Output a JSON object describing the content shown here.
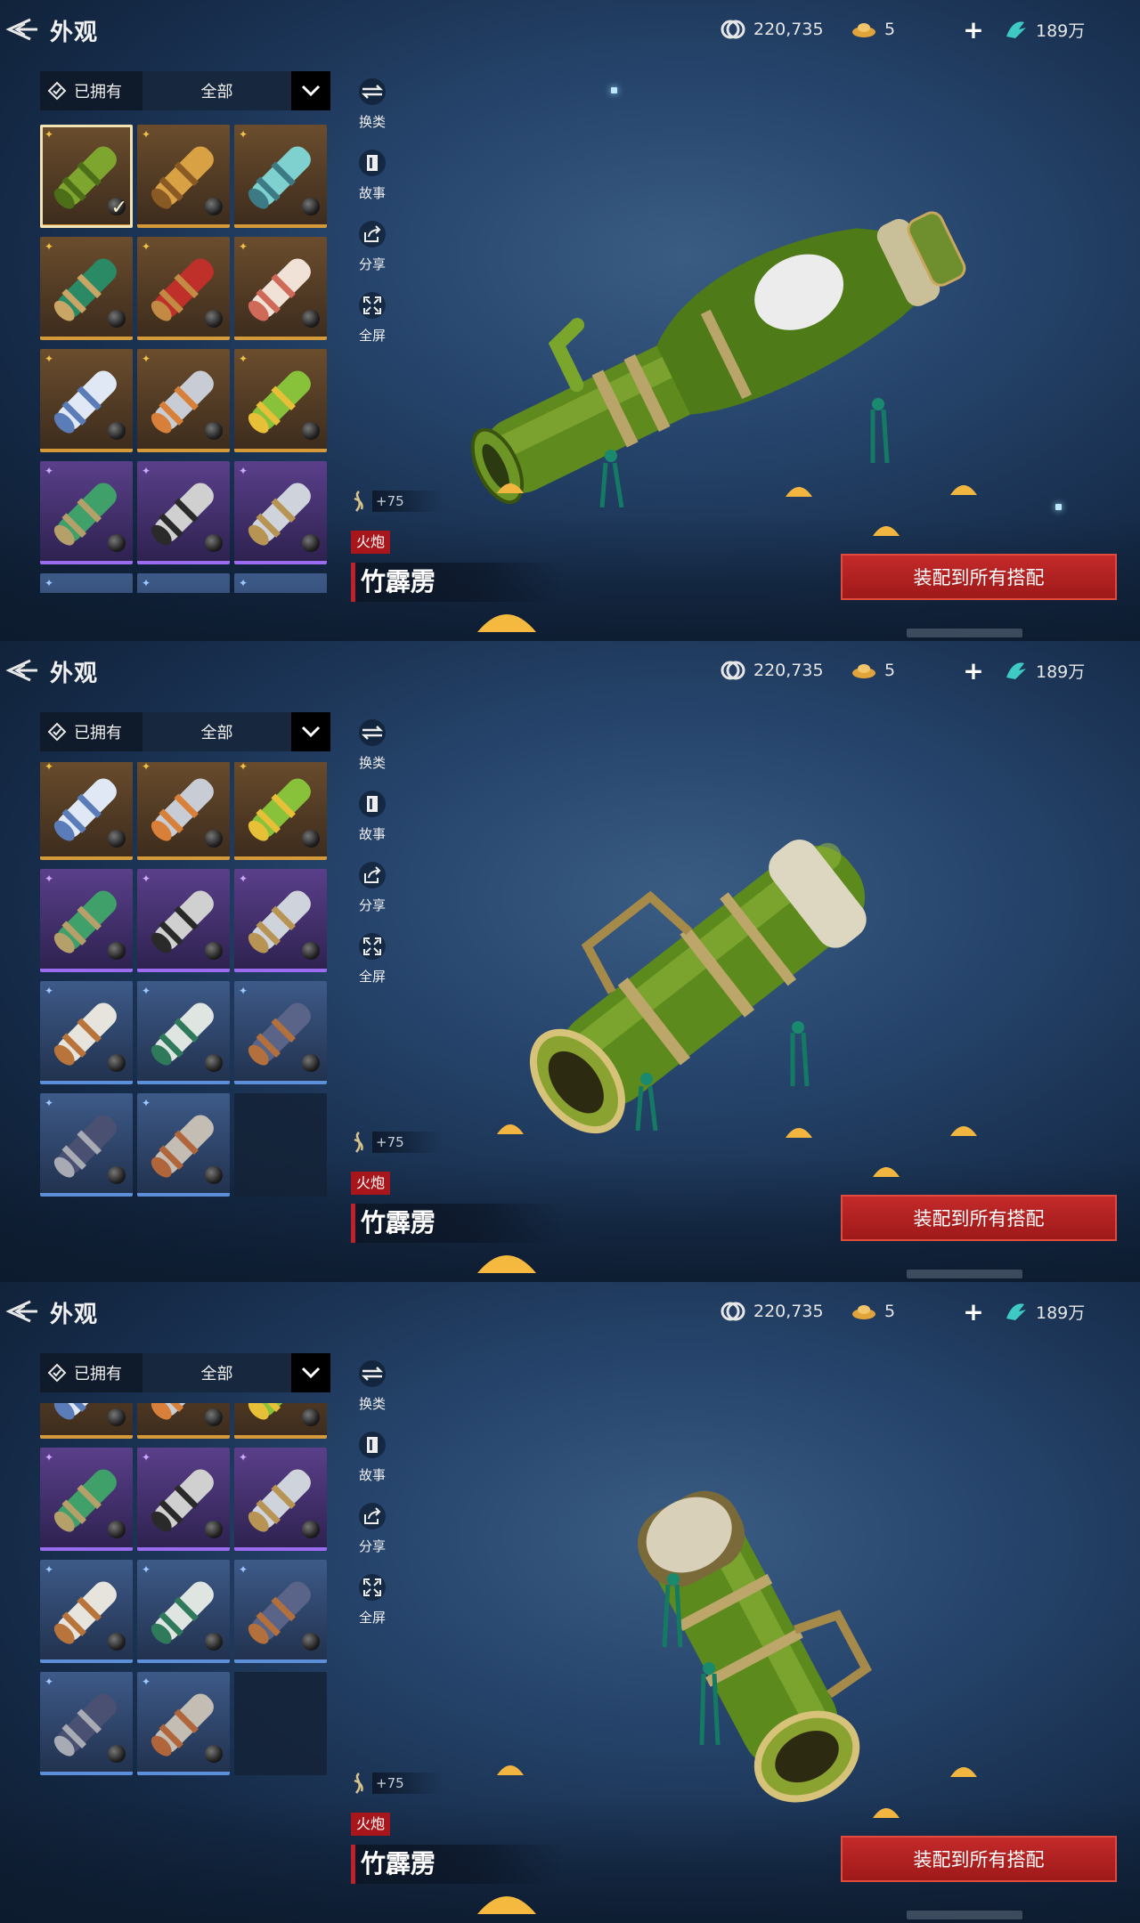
{
  "header": {
    "title": "外观",
    "currency1": "220,735",
    "currency2": "5",
    "currency3": "189万"
  },
  "filter": {
    "owned_label": "已拥有",
    "selected": "全部"
  },
  "actions": {
    "swap": "换类",
    "story": "故事",
    "share": "分享",
    "fullscreen": "全屏"
  },
  "item": {
    "enhance": "+75",
    "type": "火炮",
    "name": "竹霹雳"
  },
  "equip_button": "装配到所有搭配",
  "colors": {
    "accent_red": "#a8161c",
    "gold_rarity": "#d49a3a",
    "purple_rarity": "#9c6cf0",
    "blue_rarity": "#5d8fd8"
  },
  "icons": [
    "back-arrow-icon",
    "coin-icon",
    "ingot-icon",
    "add-icon",
    "jade-icon",
    "diamond-check-icon",
    "chevron-down-icon",
    "swap-icon",
    "story-icon",
    "share-icon",
    "fullscreen-icon",
    "enhance-icon"
  ],
  "views": [
    {
      "view": "top-of-list",
      "selected_item": 1
    },
    {
      "view": "scrolled-middle"
    },
    {
      "view": "scrolled-bottom"
    }
  ],
  "grid_items": [
    {
      "rarity": "gold",
      "theme": "bamboo",
      "owned": true
    },
    {
      "rarity": "gold",
      "theme": "golden-dragon"
    },
    {
      "rarity": "gold",
      "theme": "jade-dragon"
    },
    {
      "rarity": "gold",
      "theme": "green-serpent"
    },
    {
      "rarity": "gold",
      "theme": "red-bronze"
    },
    {
      "rarity": "gold",
      "theme": "white-crane"
    },
    {
      "rarity": "gold",
      "theme": "white-horn"
    },
    {
      "rarity": "gold",
      "theme": "silver-crystal"
    },
    {
      "rarity": "gold",
      "theme": "corn-yellow"
    },
    {
      "rarity": "purple",
      "theme": "jade-band"
    },
    {
      "rarity": "purple",
      "theme": "silver-black"
    },
    {
      "rarity": "purple",
      "theme": "silver-gold"
    },
    {
      "rarity": "blue",
      "theme": "white-copper"
    },
    {
      "rarity": "blue",
      "theme": "white-green"
    },
    {
      "rarity": "blue",
      "theme": "navy-copper"
    },
    {
      "rarity": "blue",
      "theme": "navy-steel"
    },
    {
      "rarity": "blue",
      "theme": "rust-steel"
    }
  ]
}
